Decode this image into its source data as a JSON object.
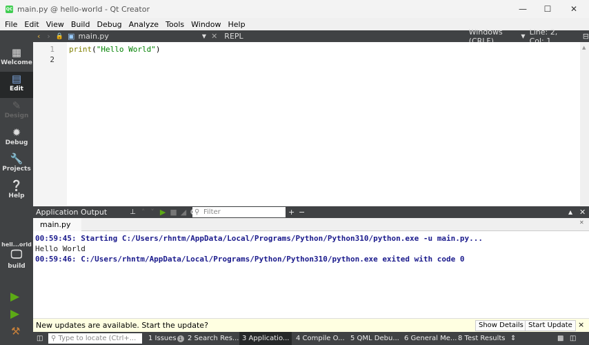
{
  "window": {
    "title": "main.py @ hello-world - Qt Creator",
    "app_icon": "QC"
  },
  "menu": [
    "File",
    "Edit",
    "View",
    "Build",
    "Debug",
    "Analyze",
    "Tools",
    "Window",
    "Help"
  ],
  "modes": [
    {
      "label": "Welcome",
      "icon": "grid-icon"
    },
    {
      "label": "Edit",
      "icon": "document-icon"
    },
    {
      "label": "Design",
      "icon": "pen-icon"
    },
    {
      "label": "Debug",
      "icon": "bug-icon"
    },
    {
      "label": "Projects",
      "icon": "wrench-icon"
    },
    {
      "label": "Help",
      "icon": "help-icon"
    }
  ],
  "kit": {
    "project": "hell...orld",
    "config": "build"
  },
  "editor_toolbar": {
    "file": "main.py",
    "repl": "REPL",
    "line_ending": "Windows (CRLF)",
    "position": "Line: 2, Col: 1"
  },
  "editor": {
    "line_numbers": [
      "1",
      "2"
    ],
    "code": [
      {
        "fn": "print",
        "open": "(",
        "str": "\"Hello World\"",
        "close": ")"
      }
    ]
  },
  "output_pane": {
    "title": "Application Output",
    "filter_placeholder": "Filter",
    "tab": "main.py",
    "lines": [
      "00:59:45: Starting C:/Users/rhntm/AppData/Local/Programs/Python/Python310/python.exe -u main.py...",
      "Hello World",
      "00:59:46: C:/Users/rhntm/AppData/Local/Programs/Python/Python310/python.exe exited with code 0"
    ]
  },
  "update_bar": {
    "message": "New updates are available. Start the update?",
    "show_details": "Show Details",
    "start_update": "Start Update",
    "close": "×"
  },
  "status_bar": {
    "locator_placeholder": "Type to locate (Ctrl+...",
    "issues_badge": "1",
    "panes": [
      "1 Issues",
      "2 Search Res...",
      "3 Applicatio...",
      "4 Compile O...",
      "5 QML Debu...",
      "6 General Me...",
      "8 Test Results"
    ]
  },
  "colors": {
    "sidebar": "#404244",
    "accent_green": "#5caa15",
    "output_blue": "#1a1a8c"
  }
}
